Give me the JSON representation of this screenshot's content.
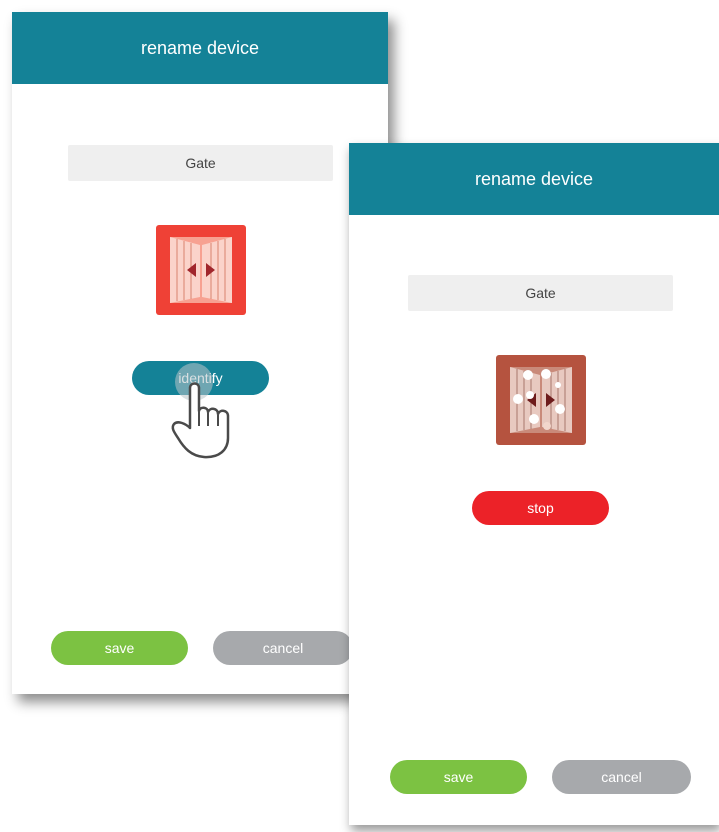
{
  "colors": {
    "titlebar": "#148297",
    "identify": "#148297",
    "stop": "#ec2228",
    "save": "#7cc242",
    "cancel": "#a7a9ac",
    "field_bg": "#efefef",
    "icon_active": "#ef4136",
    "icon_identifying": "#b5533f"
  },
  "screen_a": {
    "title": "rename device",
    "device_name": "Gate",
    "device_icon": "gate-icon",
    "identify_label": "identify",
    "save_label": "save",
    "cancel_label": "cancel",
    "cursor_icon": "hand-pointer-icon"
  },
  "screen_b": {
    "title": "rename device",
    "device_name": "Gate",
    "device_icon": "gate-identifying-icon",
    "stop_label": "stop",
    "save_label": "save",
    "cancel_label": "cancel"
  }
}
